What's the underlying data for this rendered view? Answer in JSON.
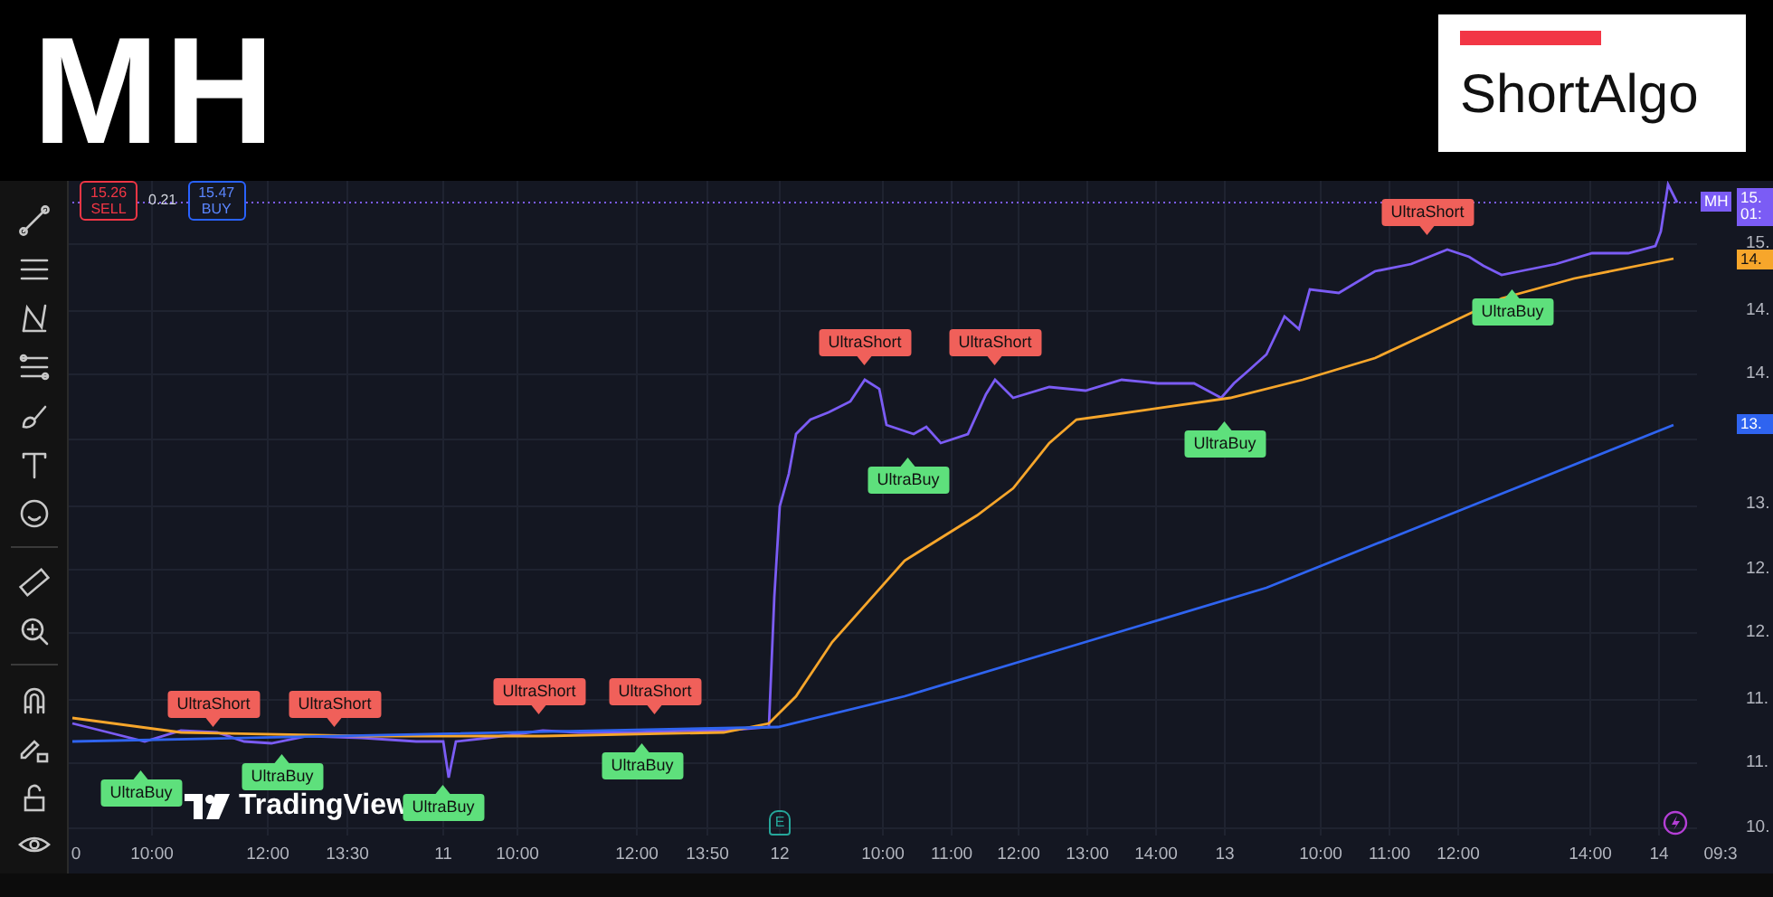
{
  "header": {
    "symbol": "MH",
    "logo": "ShortAlgo"
  },
  "trade_panel": {
    "sell_price": "15.26",
    "sell_label": "SELL",
    "spread": "0.21",
    "buy_price": "15.47",
    "buy_label": "BUY"
  },
  "watermark": "TradingView",
  "signals": [
    {
      "kind": "buy",
      "label": "UltraBuy"
    },
    {
      "kind": "short",
      "label": "UltraShort"
    },
    {
      "kind": "buy",
      "label": "UltraBuy"
    },
    {
      "kind": "short",
      "label": "UltraShort"
    },
    {
      "kind": "buy",
      "label": "UltraBuy"
    },
    {
      "kind": "short",
      "label": "UltraShort"
    },
    {
      "kind": "buy",
      "label": "UltraBuy"
    },
    {
      "kind": "short",
      "label": "UltraShort"
    },
    {
      "kind": "short",
      "label": "UltraShort"
    },
    {
      "kind": "buy",
      "label": "UltraBuy"
    },
    {
      "kind": "short",
      "label": "UltraShort"
    },
    {
      "kind": "buy",
      "label": "UltraBuy"
    },
    {
      "kind": "short",
      "label": "UltraShort"
    },
    {
      "kind": "buy",
      "label": "UltraBuy"
    }
  ],
  "price_axis": [
    "15.",
    "14.",
    "14.",
    "13.",
    "12.",
    "12.",
    "11.",
    "11.",
    "10."
  ],
  "price_badges": [
    {
      "kind": "symbol",
      "label": "MH",
      "value": "15.",
      "countdown": "01:",
      "color": "#7b5cf5"
    },
    {
      "kind": "line",
      "value": "14.",
      "color": "#f7a62b"
    },
    {
      "kind": "line",
      "value": "13.",
      "color": "#2f64f0"
    }
  ],
  "time_axis": [
    "0",
    "10:00",
    "12:00",
    "13:30",
    "11",
    "10:00",
    "12:00",
    "13:50",
    "12",
    "10:00",
    "11:00",
    "12:00",
    "13:00",
    "14:00",
    "13",
    "10:00",
    "11:00",
    "12:00",
    "14:00",
    "14",
    "09:3"
  ],
  "events": [
    {
      "kind": "earnings",
      "label": "E"
    },
    {
      "kind": "split"
    }
  ]
}
